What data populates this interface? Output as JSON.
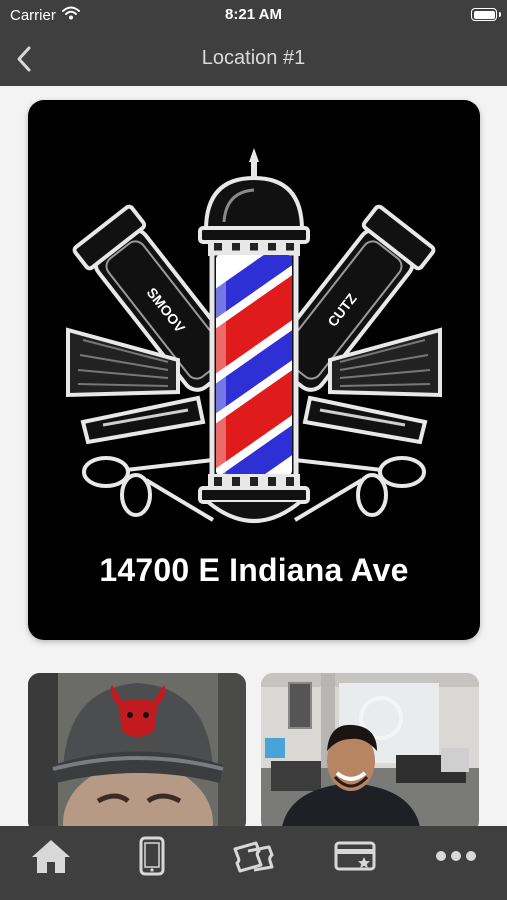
{
  "status_bar": {
    "carrier": "Carrier",
    "time": "8:21 AM"
  },
  "nav": {
    "title": "Location #1"
  },
  "hero": {
    "address": "14700 E Indiana Ave",
    "logo_clipper_left_text": "SMOOV",
    "logo_clipper_right_text": "CUTZ"
  },
  "tabs": [
    {
      "icon": "home-icon"
    },
    {
      "icon": "phone-icon"
    },
    {
      "icon": "tickets-icon"
    },
    {
      "icon": "loyalty-card-icon"
    },
    {
      "icon": "more-icon"
    }
  ],
  "colors": {
    "bar_background": "#3f3f3f",
    "icon_color": "#d8d8d8",
    "content_background": "#f3f3f3",
    "pole_red": "#e01b1b",
    "pole_blue": "#2f2fd6"
  }
}
